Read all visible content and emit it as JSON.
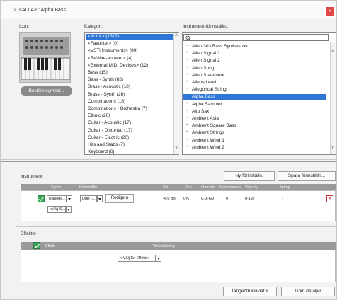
{
  "window": {
    "title": "2. <ALLA> : Alpha Bass",
    "close": "×"
  },
  "labels": {
    "icon": "Icon:",
    "category": "Kategori:",
    "presets": "Instrument-förinställn.:"
  },
  "icon": {
    "set_symbol_button": "Bestäm symbol..."
  },
  "categories": [
    "<ALLA> (1317)",
    "<Favoriter> (0)",
    "<VSTi Instruments> (80)",
    "<ReWire-enheter> (4)",
    "<External MIDI Devices> (12)",
    "Bass (15)",
    "Bass - Synth (82)",
    "Brass - Acoustic (16)",
    "Brass - Synth (26)",
    "Combinations (16)",
    "Combinations - Orchestra (7)",
    "Ethnic (20)",
    "Guitar - Acoustic (17)",
    "Guitar - Distorted (17)",
    "Guitar - Electric (20)",
    "Hits and Stabs (7)",
    "Keyboard (6)"
  ],
  "selected_category": 0,
  "preset_search": {
    "value": ""
  },
  "presets": [
    "Alien 303 Bass Synthesizer",
    "Alien Signal 1",
    "Alien Signal 2",
    "Alien Song",
    "Alien Statement",
    "Aliens Lead",
    "Allegorical String",
    "Alpha Bass",
    "Alpha Sampler",
    "Alto Sax",
    "Ambient Asia",
    "Ambient Square Bass",
    "Ambient Strings",
    "Ambient Wind 1",
    "Ambient Wind 2"
  ],
  "selected_preset": 7,
  "instrument": {
    "label": "Instrument",
    "new_button": "Ny förinställn.",
    "save_button": "Spara förinställn...",
    "columns": [
      "Synth",
      "Förinställn.",
      "Vol",
      "Pan",
      "Område",
      "Transponera",
      "Velocity",
      "Utgång"
    ],
    "row": {
      "synth": "Ranege...",
      "preset": "DnB -...",
      "edit_button": "Redigera",
      "vol": "-4.0 dB",
      "pan": "0%",
      "range": "C-1-G9",
      "transpose": "0",
      "velocity": "0-127",
      "output": "-"
    },
    "add_select": "<Välj S..."
  },
  "effects": {
    "label": "Effekter",
    "columns": [
      "Effekt",
      "Förinställning"
    ],
    "select": "< Välj En Effekt >"
  },
  "footer": {
    "keyboard_button": "Tangentb.klaviatur",
    "hide_button": "Göm detaljer"
  }
}
